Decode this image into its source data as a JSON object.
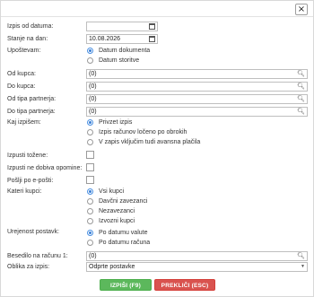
{
  "dialog": {
    "close_symbol": "×"
  },
  "fields": {
    "date_from": {
      "label": "Izpis od datuma:",
      "value": "",
      "icon": "calendar-icon"
    },
    "date_as_of": {
      "label": "Stanje na dan:",
      "value": "10.08.2026",
      "icon": "calendar-icon"
    },
    "from_buyer": {
      "label": "Od kupca:",
      "value": "(0)",
      "icon": "search-icon"
    },
    "to_buyer": {
      "label": "Do kupca:",
      "value": "(0)",
      "icon": "search-icon"
    },
    "from_partner_type": {
      "label": "Od tipa partnerja:",
      "value": "(0)",
      "icon": "search-icon"
    },
    "to_partner_type": {
      "label": "Do tipa partnerja:",
      "value": "(0)",
      "icon": "search-icon"
    },
    "text_on_invoice": {
      "label": "Besedilo na računu 1:",
      "value": "(0)",
      "icon": "search-icon"
    },
    "print_form": {
      "label": "Oblika za izpis:",
      "value": "Odprte postavke",
      "icon": "chevron-down-icon"
    }
  },
  "consider": {
    "label": "Upoštevam:",
    "options": [
      "Datum dokumenta",
      "Datum storitve"
    ],
    "selected": 0
  },
  "print_what": {
    "label": "Kaj izpišem:",
    "options": [
      "Privzet izpis",
      "Izpis računov ločeno po obrokih",
      "V zapis vključim tudi avansna plačila"
    ],
    "selected": 0
  },
  "checkboxes": {
    "exclude_sued": {
      "label": "Izpusti tožene:",
      "checked": false
    },
    "exclude_no_reminders": {
      "label": "Izpusti ne dobiva opomine:",
      "checked": false
    },
    "send_email": {
      "label": "Pošlji po e-pošti:",
      "checked": false
    }
  },
  "buyers": {
    "label": "Kateri kupci:",
    "options": [
      "Vsi kupci",
      "Davčni zavezanci",
      "Nezavezanci",
      "Izvozni kupci"
    ],
    "selected": 0
  },
  "sorting": {
    "label": "Urejenost postavk:",
    "options": [
      "Po datumu valute",
      "Po datumu računa"
    ],
    "selected": 0
  },
  "buttons": {
    "print": "IZPIŠI (F9)",
    "cancel": "PREKLIČI (ESC)"
  },
  "colors": {
    "print_button": "#5cb85c",
    "cancel_button": "#d9534f",
    "radio_accent": "#3a7fd5"
  }
}
